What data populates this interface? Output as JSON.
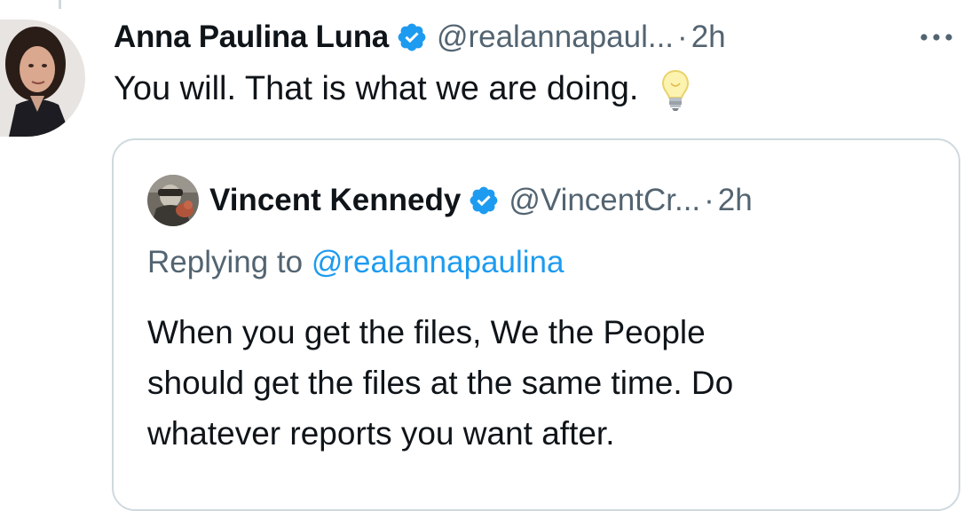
{
  "tweet": {
    "author_name": "Anna Paulina Luna",
    "author_handle": "@realannapaul...",
    "separator": "·",
    "time": "2h",
    "text": "You will. That is what we are doing.",
    "emoji_icon": "light-bulb-icon",
    "more_icon": "more-horizontal-icon"
  },
  "quote": {
    "author_name": "Vincent Kennedy",
    "author_handle": "@VincentCr...",
    "separator": "·",
    "time": "2h",
    "replying_prefix": "Replying to",
    "replying_handle": "@realannapaulina",
    "text_lines": [
      "When you get the files, We the People",
      "should get the files at the same time. Do",
      "whatever reports you want after."
    ]
  },
  "colors": {
    "text_primary": "#0f1419",
    "text_secondary": "#536471",
    "link": "#1d9bf0",
    "verified": "#1d9bf0",
    "border": "#cfd9de"
  }
}
